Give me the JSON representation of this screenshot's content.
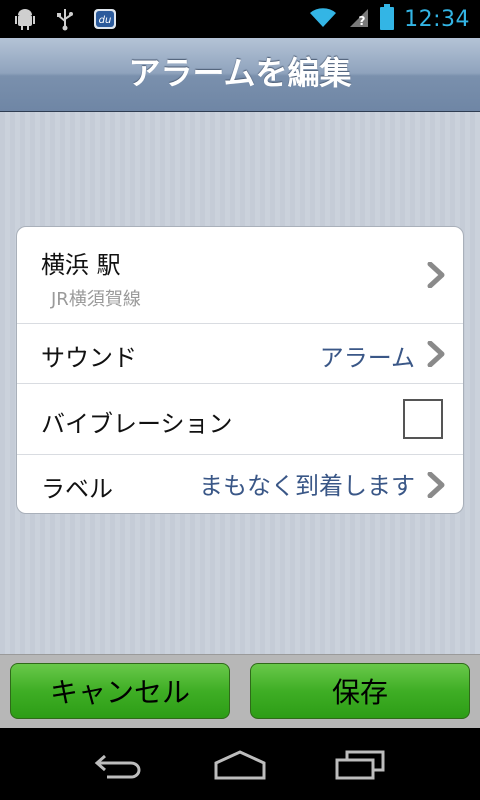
{
  "status_bar": {
    "time": "12:34",
    "icons": [
      "android-debug-icon",
      "usb-icon",
      "du-app-icon",
      "wifi-icon",
      "no-signal-icon",
      "battery-icon"
    ]
  },
  "nav": {
    "title": "アラームを編集"
  },
  "table": {
    "station": {
      "name": "横浜 駅",
      "line": "JR横須賀線"
    },
    "sound": {
      "label": "サウンド",
      "value": "アラーム"
    },
    "vibration": {
      "label": "バイブレーション",
      "checked": false
    },
    "label_row": {
      "label": "ラベル",
      "value": "まもなく到着します"
    }
  },
  "buttons": {
    "cancel": "キャンセル",
    "save": "保存"
  },
  "colors": {
    "accent_time": "#33b5e5",
    "button_green": "#3fae25",
    "value_blue": "#3a5787"
  }
}
